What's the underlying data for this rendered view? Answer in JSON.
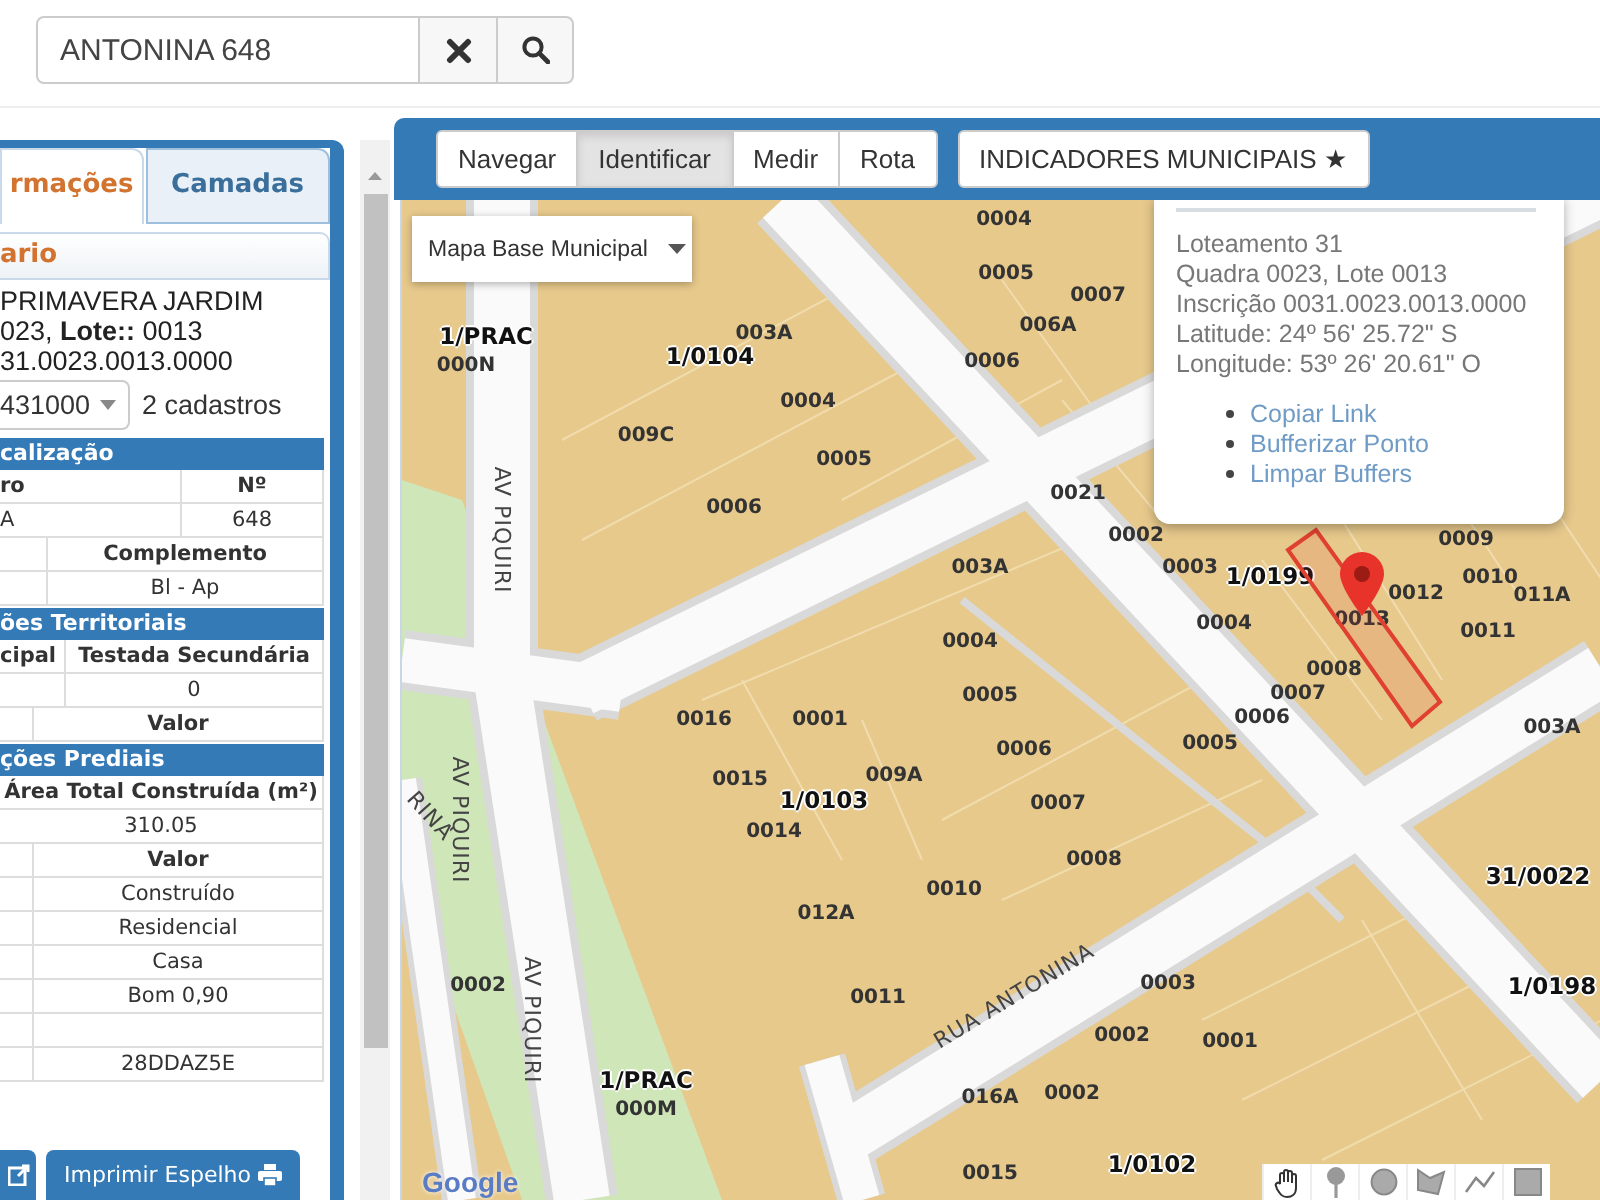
{
  "search": {
    "value": "ANTONINA 648"
  },
  "left_panel": {
    "tabs": [
      {
        "label": "rmações",
        "selected": true
      },
      {
        "label": "Camadas",
        "selected": false
      }
    ],
    "heading": "ario",
    "summary_lines": [
      "PRIMAVERA JARDIM",
      "023, **Lote::** 0013",
      "31.0023.0013.0000"
    ],
    "cadastro_select": {
      "value": "431000"
    },
    "cadastro_count": "2 cadastros",
    "sections": [
      {
        "title": "calização",
        "rows": [
          {
            "kind": "wide",
            "header": true,
            "cells": [
              "ro",
              "Nº"
            ]
          },
          {
            "kind": "wide",
            "header": false,
            "cells": [
              "A",
              "648"
            ]
          },
          {
            "kind": "narrow",
            "header": true,
            "cells": [
              "",
              "Complemento"
            ]
          },
          {
            "kind": "narrow",
            "header": false,
            "cells": [
              "",
              "Bl - Ap"
            ]
          }
        ]
      },
      {
        "title": "ões Territoriais",
        "rows": [
          {
            "kind": "slim",
            "header": true,
            "cells": [
              "cipal",
              "Testada Secundária"
            ]
          },
          {
            "kind": "slim",
            "header": false,
            "cells": [
              "",
              "0"
            ]
          },
          {
            "kind": "tiny",
            "header": true,
            "cells": [
              "",
              "Valor"
            ]
          }
        ]
      },
      {
        "title": "ções Prediais",
        "rows": [
          {
            "kind": "full",
            "header": true,
            "cells": [
              "Área Total Construída (m²)"
            ]
          },
          {
            "kind": "full",
            "header": false,
            "cells": [
              "310.05"
            ]
          },
          {
            "kind": "tiny",
            "header": true,
            "cells": [
              "",
              "Valor"
            ]
          },
          {
            "kind": "tiny",
            "header": false,
            "cells": [
              "",
              "Construído"
            ]
          },
          {
            "kind": "tiny",
            "header": false,
            "cells": [
              "",
              "Residencial"
            ]
          },
          {
            "kind": "tiny",
            "header": false,
            "cells": [
              "",
              "Casa"
            ]
          },
          {
            "kind": "tiny",
            "header": false,
            "cells": [
              "",
              "Bom 0,90"
            ]
          },
          {
            "kind": "tiny",
            "cells": [
              "",
              ""
            ]
          },
          {
            "kind": "tiny",
            "header": false,
            "cells": [
              "",
              "28DDAZ5E"
            ]
          }
        ]
      }
    ],
    "print_button": {
      "label": "Imprimir Espelho"
    }
  },
  "toolbar": {
    "buttons": [
      {
        "label": "Navegar",
        "selected": false
      },
      {
        "label": "Identificar",
        "selected": true
      },
      {
        "label": "Medir",
        "selected": false
      },
      {
        "label": "Rota",
        "selected": false
      }
    ],
    "indicators_button": {
      "label": "INDICADORES MUNICIPAIS ★"
    }
  },
  "map": {
    "layer_select": {
      "value": "Mapa Base Municipal"
    },
    "labels": [
      {
        "kind": "block",
        "text": "1/PRAC"
      },
      {
        "kind": "block",
        "text": "1/0104"
      },
      {
        "kind": "block",
        "text": "1/0199"
      },
      {
        "kind": "block",
        "text": "1/0103"
      },
      {
        "kind": "block",
        "text": "31/0022"
      },
      {
        "kind": "block",
        "text": "1/0198"
      },
      {
        "kind": "block",
        "text": "1/PRAC"
      },
      {
        "kind": "block",
        "text": "1/0102"
      },
      {
        "kind": "lot",
        "text": "000N"
      },
      {
        "kind": "lot",
        "text": "003A"
      },
      {
        "kind": "lot",
        "text": "0004"
      },
      {
        "kind": "lot",
        "text": "009C"
      },
      {
        "kind": "lot",
        "text": "0005"
      },
      {
        "kind": "lot",
        "text": "0006"
      },
      {
        "kind": "lot",
        "text": "0004"
      },
      {
        "kind": "lot",
        "text": "0005"
      },
      {
        "kind": "lot",
        "text": "0007"
      },
      {
        "kind": "lot",
        "text": "006A"
      },
      {
        "kind": "lot",
        "text": "0006"
      },
      {
        "kind": "lot",
        "text": "0021"
      },
      {
        "kind": "lot",
        "text": "0002"
      },
      {
        "kind": "lot",
        "text": "0003"
      },
      {
        "kind": "lot",
        "text": "0004"
      },
      {
        "kind": "lot",
        "text": "0012"
      },
      {
        "kind": "lot",
        "text": "0013"
      },
      {
        "kind": "lot",
        "text": "0008"
      },
      {
        "kind": "lot",
        "text": "0007"
      },
      {
        "kind": "lot",
        "text": "0006"
      },
      {
        "kind": "lot",
        "text": "0005"
      },
      {
        "kind": "lot",
        "text": "0009"
      },
      {
        "kind": "lot",
        "text": "0010"
      },
      {
        "kind": "lot",
        "text": "011A"
      },
      {
        "kind": "lot",
        "text": "0011"
      },
      {
        "kind": "lot",
        "text": "003A"
      },
      {
        "kind": "lot",
        "text": "0004"
      },
      {
        "kind": "lot",
        "text": "0005"
      },
      {
        "kind": "lot",
        "text": "0016"
      },
      {
        "kind": "lot",
        "text": "0001"
      },
      {
        "kind": "lot",
        "text": "009A"
      },
      {
        "kind": "lot",
        "text": "0006"
      },
      {
        "kind": "lot",
        "text": "0015"
      },
      {
        "kind": "lot",
        "text": "0014"
      },
      {
        "kind": "lot",
        "text": "0007"
      },
      {
        "kind": "lot",
        "text": "0008"
      },
      {
        "kind": "lot",
        "text": "0010"
      },
      {
        "kind": "lot",
        "text": "012A"
      },
      {
        "kind": "lot",
        "text": "0011"
      },
      {
        "kind": "lot",
        "text": "0002"
      },
      {
        "kind": "lot",
        "text": "000M"
      },
      {
        "kind": "lot",
        "text": "0003"
      },
      {
        "kind": "lot",
        "text": "0002"
      },
      {
        "kind": "lot",
        "text": "0001"
      },
      {
        "kind": "lot",
        "text": "016A"
      },
      {
        "kind": "lot",
        "text": "0002"
      },
      {
        "kind": "lot",
        "text": "0015"
      },
      {
        "kind": "lot",
        "text": "003A"
      },
      {
        "kind": "street",
        "text": "AV PIQUIRI"
      },
      {
        "kind": "street",
        "text": "AV PIQUIRI"
      },
      {
        "kind": "street",
        "text": "AV PIQUIRI"
      },
      {
        "kind": "street",
        "text": "RUA ANTONINA"
      },
      {
        "kind": "street",
        "text": "RINA"
      }
    ],
    "popup": {
      "lines": [
        "Loteamento 31",
        "Quadra 0023, Lote 0013",
        "Inscrição 0031.0023.0013.0000",
        "Latitude: 24º 56' 25.72\" S",
        "Longitude: 53º 26' 20.61\" O"
      ],
      "links": [
        "Copiar Link",
        "Bufferizar Ponto",
        "Limpar Buffers"
      ]
    },
    "attribution": "Google"
  }
}
